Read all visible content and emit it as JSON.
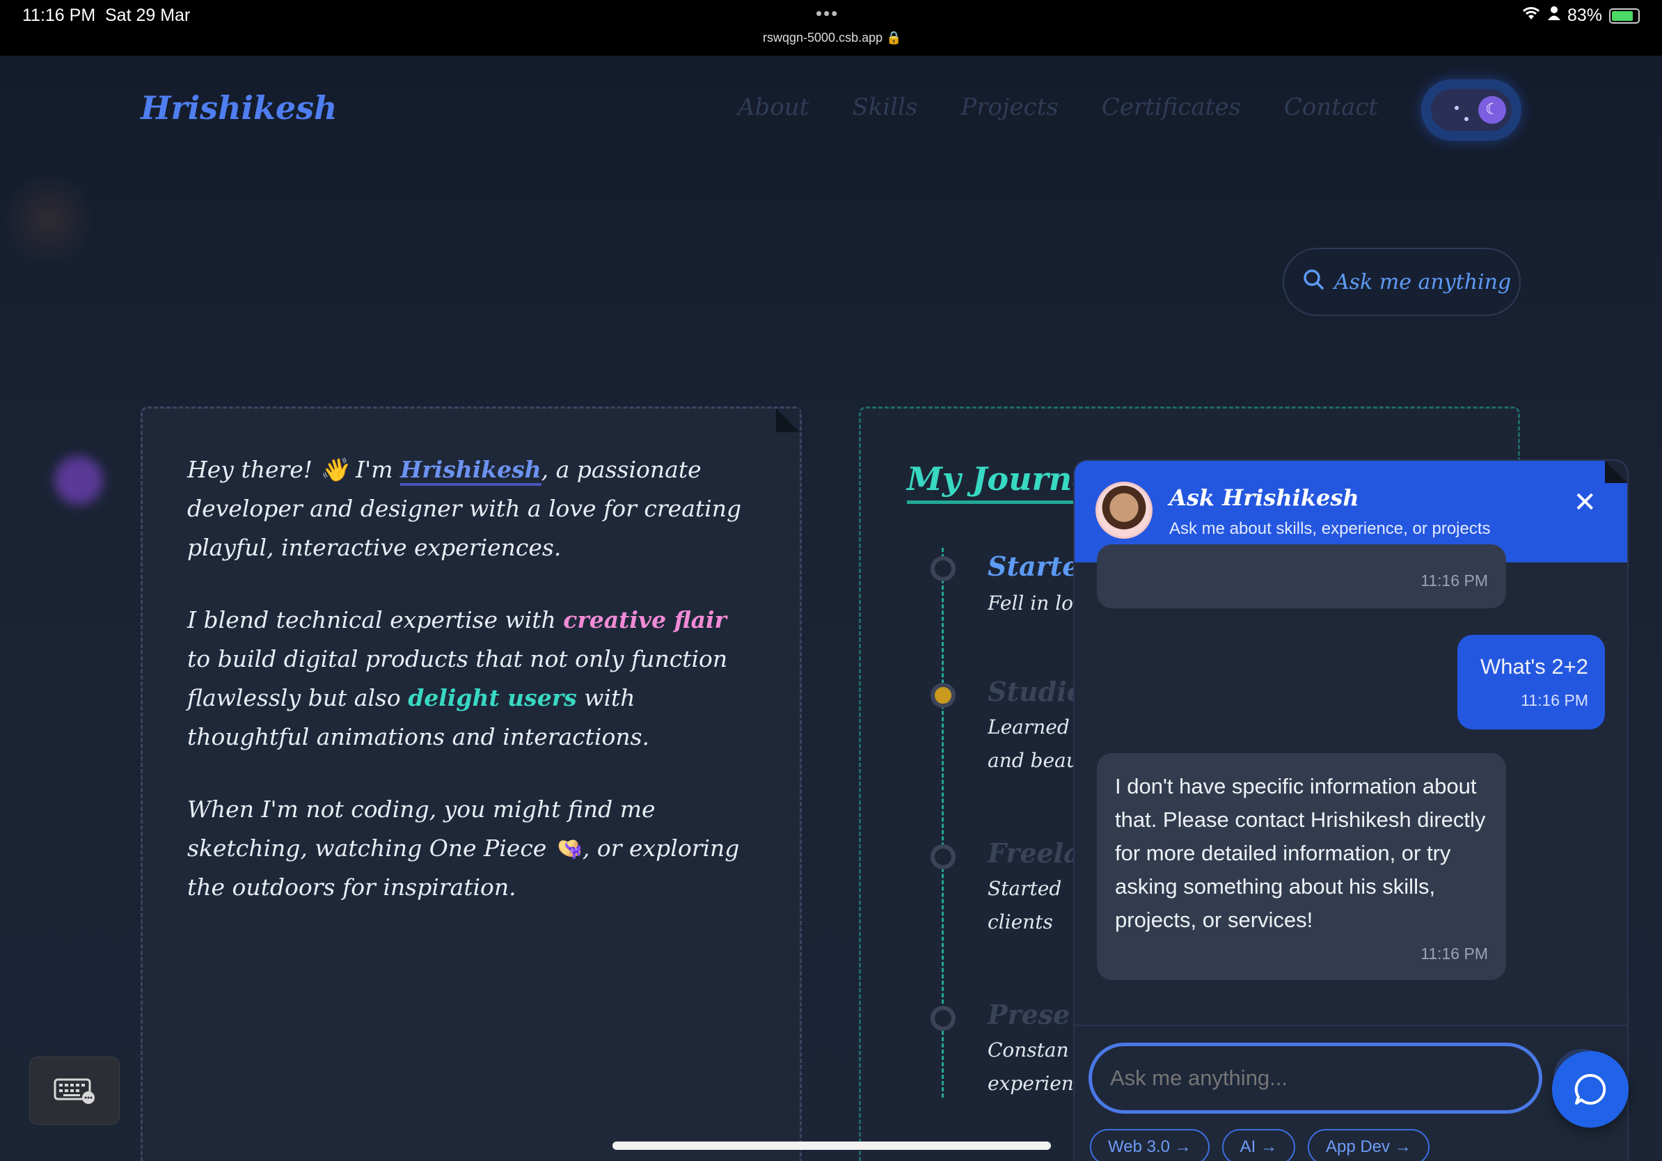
{
  "status_bar": {
    "time": "11:16 PM",
    "date": "Sat 29 Mar",
    "url": "rswqgn-5000.csb.app",
    "battery": "83%"
  },
  "nav": {
    "logo": "Hrishikesh",
    "links": [
      "About",
      "Skills",
      "Projects",
      "Certificates",
      "Contact"
    ]
  },
  "search_pill": {
    "label": "Ask me anything"
  },
  "about": {
    "p1_a": "Hey there! 👋 I'm ",
    "p1_name": "Hrishikesh",
    "p1_b": ", a passionate developer and designer with a love for creating playful, interactive experiences.",
    "p2_a": "I blend technical expertise with ",
    "p2_hl1": "creative flair",
    "p2_b": " to build digital products that not only function flawlessly but also ",
    "p2_hl2": "delight users",
    "p2_c": " with thoughtful animations and interactions.",
    "p3": "When I'm not coding, you might find me sketching, watching One Piece 👒, or exploring the outdoors for inspiration."
  },
  "journey": {
    "title": "My Journe",
    "items": [
      {
        "title": "Starte",
        "desc": "Fell in lo",
        "color": "#5d9bf5"
      },
      {
        "title": "Studie",
        "desc": "Learned and beau",
        "color": "#3a4458"
      },
      {
        "title": "Freela",
        "desc": "Started clients",
        "color": "#3a4458"
      },
      {
        "title": "Prese",
        "desc": "Constan experien",
        "color": "#3a4458"
      }
    ]
  },
  "chat": {
    "title": "Ask Hrishikesh",
    "subtitle": "Ask me about skills, experience, or projects",
    "messages": [
      {
        "from": "bot",
        "text": "",
        "time": "11:16 PM"
      },
      {
        "from": "user",
        "text": "What's 2+2",
        "time": "11:16 PM"
      },
      {
        "from": "bot",
        "text": "I don't have specific information about that. Please contact Hrishikesh directly for more detailed information, or try asking something about his skills, projects, or services!",
        "time": "11:16 PM"
      }
    ],
    "input_placeholder": "Ask me anything...",
    "chips": [
      "Web 3.0 →",
      "AI →",
      "App Dev →"
    ]
  },
  "colors": {
    "accent": "#2457e0",
    "teal": "#38d9c2",
    "pink": "#f28bd6",
    "background": "#1b2536"
  }
}
